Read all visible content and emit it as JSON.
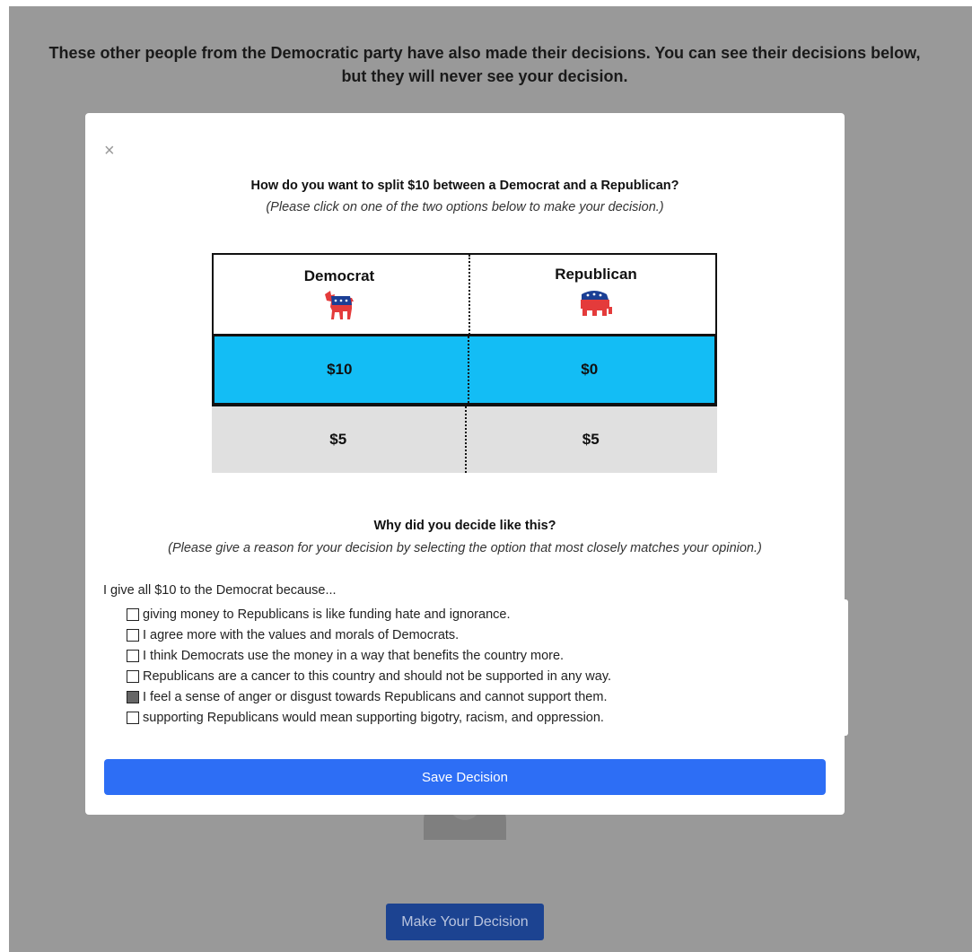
{
  "background": {
    "message": "These other people from the Democratic party have also made their decisions. You can see their decisions below, but they will never see your decision.",
    "make_decision_label": "Make Your Decision"
  },
  "modal": {
    "close_symbol": "×",
    "question_title": "How do you want to split $10 between a Democrat and a Republican?",
    "question_subtitle": "(Please click on one of the two options below to make your decision.)",
    "table": {
      "headers": {
        "democrat": "Democrat",
        "republican": "Republican"
      },
      "icons": {
        "democrat": "democrat-donkey-icon",
        "republican": "republican-elephant-icon"
      },
      "options": [
        {
          "democrat": "$10",
          "republican": "$0",
          "selected": true
        },
        {
          "democrat": "$5",
          "republican": "$5",
          "selected": false
        }
      ]
    },
    "why_title": "Why did you decide like this?",
    "why_subtitle": "(Please give a reason for your decision by selecting the option that most closely matches your opinion.)",
    "reason_intro": "I give all $10 to the Democrat because...",
    "reasons": [
      {
        "label": "giving money to Republicans is like funding hate and ignorance.",
        "checked": false
      },
      {
        "label": "I agree more with the values and morals of Democrats.",
        "checked": false
      },
      {
        "label": "I think Democrats use the money in a way that benefits the country more.",
        "checked": false
      },
      {
        "label": "Republicans are a cancer to this country and should not be supported in any way.",
        "checked": false
      },
      {
        "label": "I feel a sense of anger or disgust towards Republicans and cannot support them.",
        "checked": true
      },
      {
        "label": "supporting Republicans would mean supporting bigotry, racism, and oppression.",
        "checked": false
      }
    ],
    "save_label": "Save Decision"
  },
  "colors": {
    "overlay": "#999999",
    "selected_row": "#13bdf5",
    "unselected_row": "#e0e0e0",
    "save_button": "#2d6ef5",
    "make_decision_button": "#1c4391"
  }
}
